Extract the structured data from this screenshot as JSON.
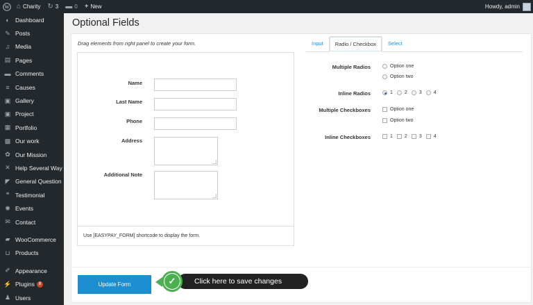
{
  "adminbar": {
    "site_name": "Charity",
    "updates_count": "3",
    "comments_count": "0",
    "new_label": "New",
    "howdy": "Howdy, admin"
  },
  "sidebar": {
    "items": [
      {
        "label": "Dashboard",
        "icon": "dashboard-icon",
        "glyph": "◐"
      },
      {
        "label": "Posts",
        "icon": "pin-icon",
        "glyph": "✎"
      },
      {
        "label": "Media",
        "icon": "media-icon",
        "glyph": "♫"
      },
      {
        "label": "Pages",
        "icon": "pages-icon",
        "glyph": "▤"
      },
      {
        "label": "Comments",
        "icon": "comments-icon",
        "glyph": "▬"
      },
      {
        "label": "Causes",
        "icon": "list-icon",
        "glyph": "≡"
      },
      {
        "label": "Gallery",
        "icon": "gallery-icon",
        "glyph": "▣"
      },
      {
        "label": "Project",
        "icon": "project-icon",
        "glyph": "▣"
      },
      {
        "label": "Portfolio",
        "icon": "portfolio-icon",
        "glyph": "▦"
      },
      {
        "label": "Our work",
        "icon": "briefcase-icon",
        "glyph": "▩"
      },
      {
        "label": "Our Mission",
        "icon": "target-icon",
        "glyph": "✿"
      },
      {
        "label": "Help Several Way",
        "icon": "network-icon",
        "glyph": "✕"
      },
      {
        "label": "General Question",
        "icon": "megaphone-icon",
        "glyph": "◤"
      },
      {
        "label": "Testimonial",
        "icon": "quote-icon",
        "glyph": "❝"
      },
      {
        "label": "Events",
        "icon": "gear-icon",
        "glyph": "✺"
      },
      {
        "label": "Contact",
        "icon": "mail-icon",
        "glyph": "✉"
      },
      {
        "label": "WooCommerce",
        "icon": "woo-icon",
        "glyph": "▰"
      },
      {
        "label": "Products",
        "icon": "cart-icon",
        "glyph": "⊔"
      },
      {
        "label": "Appearance",
        "icon": "brush-icon",
        "glyph": "✐"
      },
      {
        "label": "Plugins",
        "icon": "plugin-icon",
        "glyph": "⚡",
        "badge": "8"
      },
      {
        "label": "Users",
        "icon": "users-icon",
        "glyph": "♟"
      }
    ]
  },
  "page": {
    "title": "Optional Fields",
    "instructions": "Drag elements from right panel to create your form.",
    "shortcode_note": "Use [EASYPAY_FORM] shortcode to display the form.",
    "update_button": "Update Form"
  },
  "form": {
    "name_label": "Name",
    "last_name_label": "Last Name",
    "phone_label": "Phone",
    "address_label": "Address",
    "note_label": "Additional Note"
  },
  "tabs": [
    "Input",
    "Radio / Checkbox",
    "Select"
  ],
  "options": {
    "multiple_radios_label": "Multiple Radios",
    "radio_option_one": "Option one",
    "radio_option_two": "Option two",
    "inline_radios_label": "Inline Radios",
    "inline_radios": [
      "1",
      "2",
      "3",
      "4"
    ],
    "multiple_checkboxes_label": "Multiple Checkboxes",
    "checkbox_option_one": "Option one",
    "checkbox_option_two": "Option two",
    "inline_checkboxes_label": "Inline Checkboxes",
    "inline_checkboxes": [
      "1",
      "2",
      "3",
      "4"
    ]
  },
  "callout": {
    "text": "Click here to save changes"
  },
  "colors": {
    "sidebar_bg": "#23282d",
    "accent_blue": "#1d8ed0",
    "callout_green": "#4caf50",
    "plugin_badge": "#ca4a1f"
  }
}
